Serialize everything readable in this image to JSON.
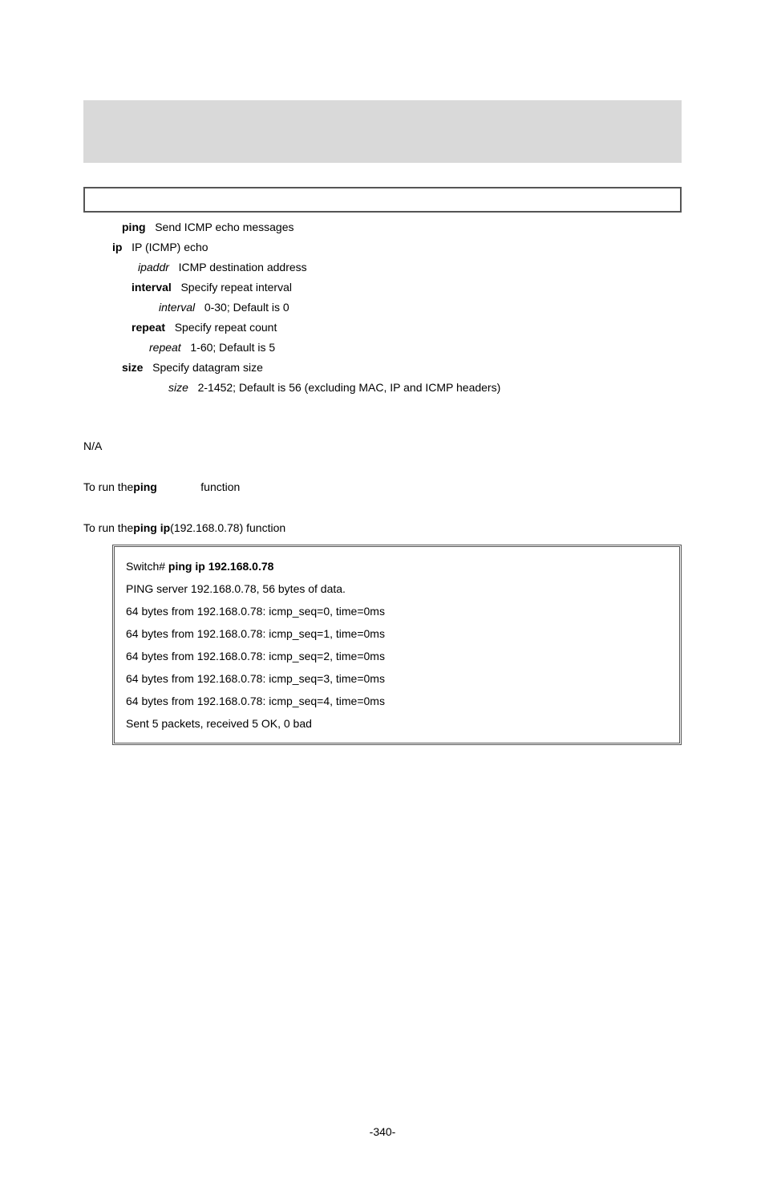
{
  "desc": {
    "ping": {
      "label": "ping   ",
      "text": "Send ICMP echo messages"
    },
    "ip": {
      "label": "ip   ",
      "text": "IP (ICMP) echo"
    },
    "ipaddr": {
      "label": "ipaddr   ",
      "text": "ICMP destination address"
    },
    "interval": {
      "label": "interval   ",
      "text": "Specify repeat interval"
    },
    "intval": {
      "label": "interval   ",
      "text": "0-30; Default is 0"
    },
    "repeat": {
      "label": "repeat   ",
      "text": "Specify repeat count"
    },
    "repval": {
      "label": "repeat   ",
      "text": "1-60; Default is 5"
    },
    "size": {
      "label": "size   ",
      "text": "Specify datagram size"
    },
    "sizeval": {
      "label": "size   ",
      "text": "2-1452; Default is 56 (excluding MAC, IP and ICMP headers)"
    }
  },
  "body": {
    "na": "N/A",
    "usage1": {
      "pre": "To run the ",
      "word": "ping",
      "post": "function"
    },
    "example1": {
      "pre": "To run the ",
      "word": "ping ip",
      "mid": " (192.168.0.78) function"
    }
  },
  "output": {
    "lines": {
      "0": {
        "a": "Switch# ",
        "b": "ping ip 192.168.0.78"
      },
      "1": "PING server 192.168.0.78, 56 bytes of data.",
      "2": "64 bytes from 192.168.0.78: icmp_seq=0, time=0ms",
      "3": "64 bytes from 192.168.0.78: icmp_seq=1, time=0ms",
      "4": "64 bytes from 192.168.0.78: icmp_seq=2, time=0ms",
      "5": "64 bytes from 192.168.0.78: icmp_seq=3, time=0ms",
      "6": "64 bytes from 192.168.0.78: icmp_seq=4, time=0ms",
      "7": "Sent 5 packets, received 5 OK, 0 bad"
    }
  },
  "footer": {
    "page": "-340-"
  }
}
